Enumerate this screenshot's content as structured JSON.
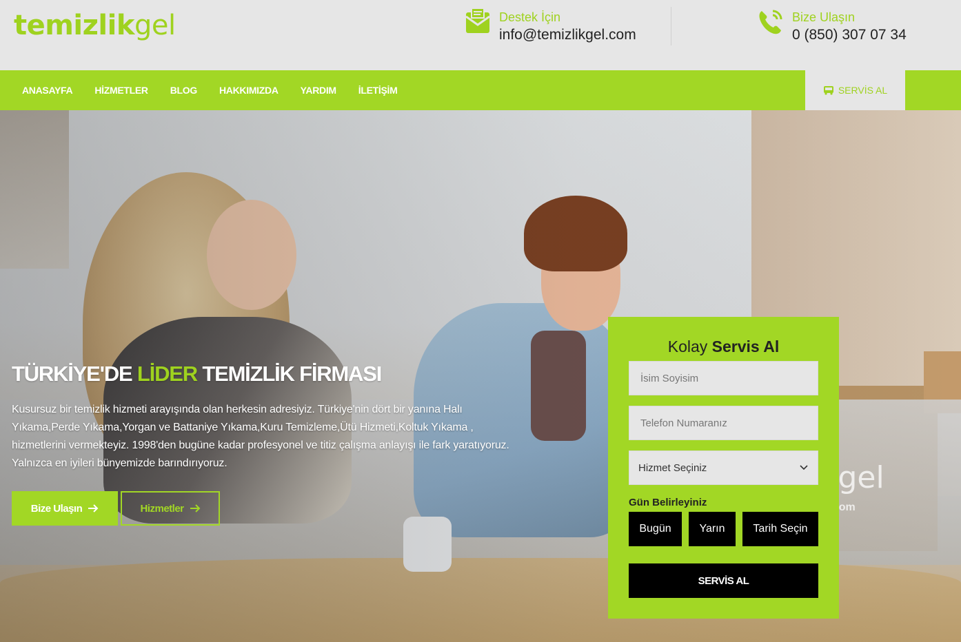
{
  "brand": {
    "logo_strong": "temizlik",
    "logo_light": "gel"
  },
  "contacts": [
    {
      "label": "Destek İçin",
      "value": "info@temizlikgel.com",
      "icon": "envelope-icon"
    },
    {
      "label": "Bize Ulaşın",
      "value": "0 (850) 307 07 34",
      "icon": "phone-icon"
    }
  ],
  "nav": {
    "items": [
      "ANASAYFA",
      "HİZMETLER",
      "BLOG",
      "HAKKIMIZDA",
      "YARDIM",
      "İLETİŞİM"
    ],
    "cta": "SERVİS AL"
  },
  "hero": {
    "title_part1": "TÜRKİYE'DE ",
    "title_accent": "LİDER",
    "title_part2": " TEMİZLİK FİRMASI",
    "description": "Kusursuz bir temizlik hizmeti arayışında olan herkesin adresiyiz. Türkiye'nin dört bir yanına Halı Yıkama,Perde Yıkama,Yorgan ve Battaniye Yıkama,Kuru Temizleme,Ütü Hizmeti,Koltuk Yıkama , hizmetlerini vermekteyiz. 1998'den bugüne kadar profesyonel ve titiz çalışma anlayışı ile fark yaratıyoruz. Yalnızca en iyileri bünyemizde barındırıyoruz.",
    "btn_contact": "Bize Ulaşın",
    "btn_services": "Hizmetler",
    "watermark": "kgel",
    "watermark_sub": "el.com"
  },
  "form": {
    "title_normal": "Kolay ",
    "title_bold": "Servis Al",
    "name_placeholder": "İsim Soyisim",
    "phone_placeholder": "Telefon Numaranız",
    "service_select": "Hizmet Seçiniz",
    "day_label": "Gün Belirleyiniz",
    "day_today": "Bugün",
    "day_tomorrow": "Yarın",
    "day_pick": "Tarih Seçin",
    "submit": "SERVİS AL"
  },
  "colors": {
    "accent": "#a2d725",
    "header_bg": "#e6e6e6",
    "dark": "#000000"
  }
}
